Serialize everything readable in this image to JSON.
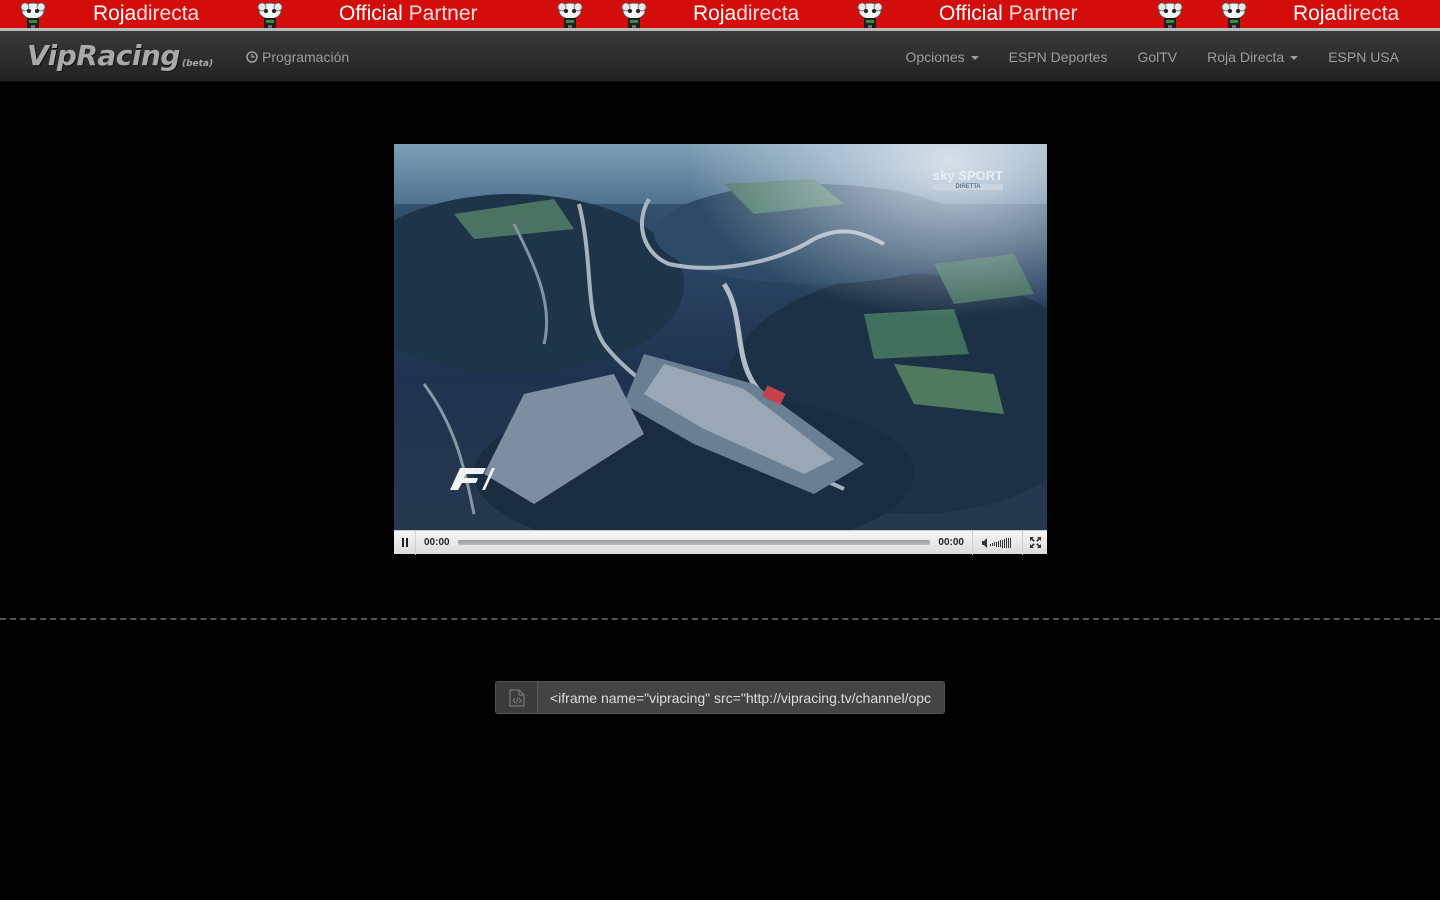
{
  "banner": {
    "segments": [
      {
        "strong": "Roja",
        "light": "directa"
      },
      {
        "strong": "Official",
        "light": "Partner"
      },
      {
        "strong": "Roja",
        "light": "directa"
      },
      {
        "strong": "Official",
        "light": "Partner"
      },
      {
        "strong": "Roja",
        "light": "directa"
      }
    ],
    "colors": {
      "background": "#d30c0c",
      "border": "#b9b9b9"
    }
  },
  "navbar": {
    "brand": {
      "name": "VipRacing",
      "badge": "(beta)"
    },
    "schedule_link": "Programación",
    "items": [
      {
        "label": "Opciones",
        "dropdown": true
      },
      {
        "label": "ESPN Deportes",
        "dropdown": false
      },
      {
        "label": "GolTV",
        "dropdown": false
      },
      {
        "label": "Roja Directa",
        "dropdown": true
      },
      {
        "label": "ESPN USA",
        "dropdown": false
      }
    ]
  },
  "player": {
    "watermark_channel": "sky SPORT",
    "watermark_sub": "DIRETTA",
    "current_time": "00:00",
    "duration": "00:00",
    "progress_fraction": 0
  },
  "embed": {
    "value": "<iframe name=\"vipracing\" src=\"http://vipracing.tv/channel/opc"
  }
}
